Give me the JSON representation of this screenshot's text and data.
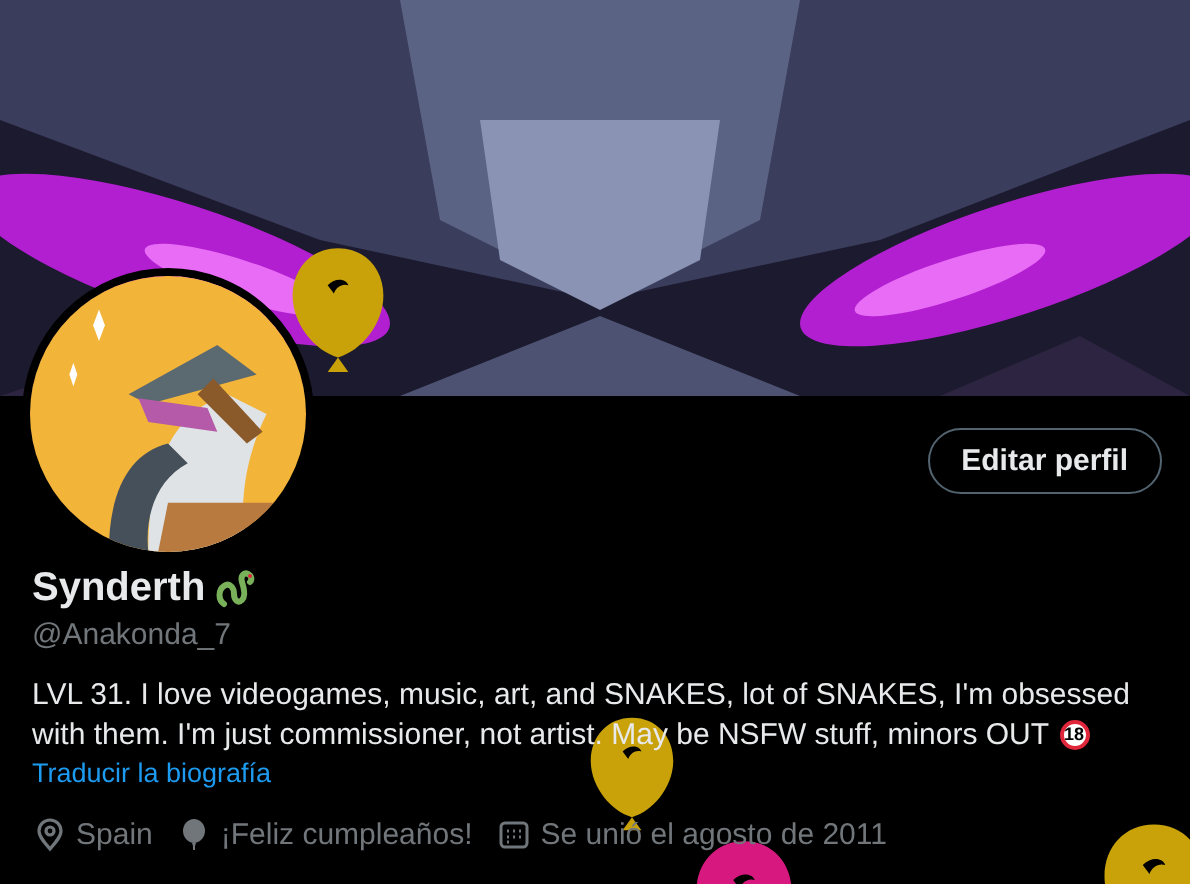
{
  "edit_button": {
    "label": "Editar perfil"
  },
  "profile": {
    "name": "Synderth",
    "handle": "@Anakonda_7",
    "bio": [
      "LVL 31.  I love videogames, music, art, and SNAKES, lot of SNAKES, I'm obsessed",
      "with them. I'm just commissioner, not artist. May be NSFW stuff, minors OUT"
    ],
    "adult_badge": "18",
    "translate_link": "Traducir la biografía"
  },
  "meta": [
    {
      "kind": "location",
      "text": "Spain"
    },
    {
      "kind": "birthday",
      "text": "¡Feliz cumpleaños!"
    },
    {
      "kind": "joined",
      "text": "Se unió el agosto de 2011"
    }
  ],
  "balloons": [
    {
      "color": "#c9a20a"
    },
    {
      "color": "#c9a20a"
    },
    {
      "color": "#d6187f"
    },
    {
      "color": "#c9a20a"
    }
  ]
}
